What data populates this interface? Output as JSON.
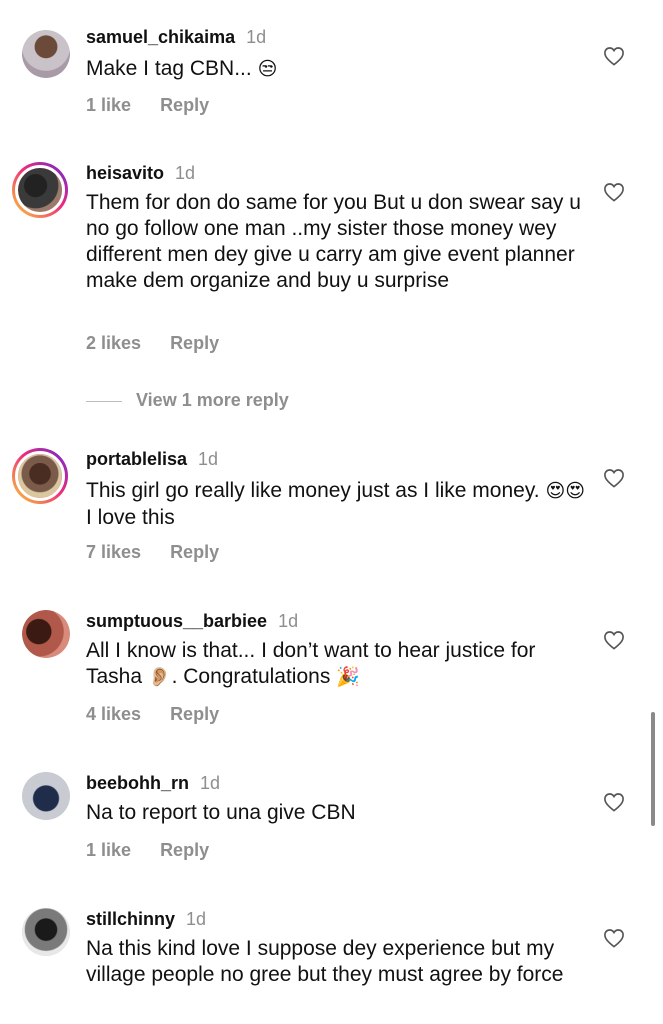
{
  "comments": [
    {
      "username": "samuel_chikaima",
      "time": "1d",
      "text": "Make I tag CBN...",
      "emoji": "😒",
      "likes": "1 like",
      "reply": "Reply"
    },
    {
      "username": "heisavito",
      "time": "1d",
      "text": "Them for don do same for you But u don swear say u no go follow one man ..my sister those money wey different men dey give u carry am give event planner make dem organize and buy u surprise",
      "likes": "2 likes",
      "reply": "Reply",
      "view_more": "View 1 more reply"
    },
    {
      "username": "portablelisa",
      "time": "1d",
      "text_a": "This girl go really like money just as I like money.",
      "emoji": "😍😍",
      "text_b": " I love this",
      "likes": "7 likes",
      "reply": "Reply"
    },
    {
      "username": "sumptuous__barbiee",
      "time": "1d",
      "text_a": "All I know is that... I don’t want to hear justice for Tasha",
      "emoji_a": "👂🏼",
      "text_b": ". Congratulations",
      "emoji_b": "🎉",
      "likes": "4 likes",
      "reply": "Reply"
    },
    {
      "username": "beebohh_rn",
      "time": "1d",
      "text": "Na to report to una give CBN",
      "likes": "1 like",
      "reply": "Reply"
    },
    {
      "username": "stillchinny",
      "time": "1d",
      "text": "Na this kind love I suppose dey experience but my village people no gree but they must agree by force"
    }
  ],
  "icons": {
    "like": "heart-outline-icon"
  },
  "colors": {
    "muted": "#8e8e8e",
    "story_ring": [
      "#f9ce34",
      "#ee2a7b",
      "#6228d7"
    ]
  }
}
